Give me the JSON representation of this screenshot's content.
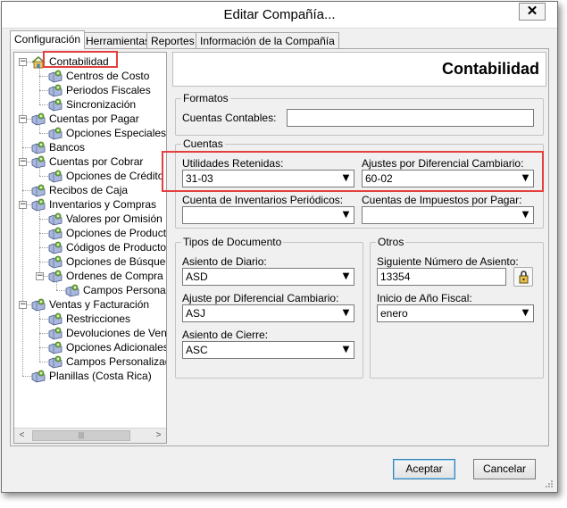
{
  "window": {
    "title": "Editar Compañía...",
    "close_glyph": "✕"
  },
  "tabs": [
    {
      "label": "Configuración",
      "active": true
    },
    {
      "label": "Herramientas",
      "active": false
    },
    {
      "label": "Reportes",
      "active": false
    },
    {
      "label": "Información de la Compañía",
      "active": false
    }
  ],
  "tree": {
    "nodes": [
      {
        "label": "Contabilidad",
        "level": 0,
        "expander": "−",
        "icon": "house-icon",
        "selected": true
      },
      {
        "label": "Centros de Costo",
        "level": 1,
        "icon": "folder-gear-icon"
      },
      {
        "label": "Periodos Fiscales",
        "level": 1,
        "icon": "folder-gear-icon"
      },
      {
        "label": "Sincronización",
        "level": 1,
        "icon": "folder-gear-icon"
      },
      {
        "label": "Cuentas por Pagar",
        "level": 0,
        "expander": "−",
        "icon": "folder-gear-icon"
      },
      {
        "label": "Opciones Especiales",
        "level": 1,
        "icon": "folder-gear-icon"
      },
      {
        "label": "Bancos",
        "level": 0,
        "icon": "folder-gear-icon"
      },
      {
        "label": "Cuentas por Cobrar",
        "level": 0,
        "expander": "−",
        "icon": "folder-gear-icon"
      },
      {
        "label": "Opciones de Crédito",
        "level": 1,
        "icon": "folder-gear-icon"
      },
      {
        "label": "Recibos de Caja",
        "level": 0,
        "icon": "folder-gear-icon"
      },
      {
        "label": "Inventarios y Compras",
        "level": 0,
        "expander": "−",
        "icon": "folder-gear-icon"
      },
      {
        "label": "Valores por Omisión",
        "level": 1,
        "icon": "folder-gear-icon"
      },
      {
        "label": "Opciones de Producto",
        "level": 1,
        "icon": "folder-gear-icon"
      },
      {
        "label": "Códigos de Producto",
        "level": 1,
        "icon": "folder-gear-icon"
      },
      {
        "label": "Opciones de Búsqueda",
        "level": 1,
        "icon": "folder-gear-icon"
      },
      {
        "label": "Ordenes de Compra",
        "level": 1,
        "expander": "−",
        "icon": "folder-gear-icon"
      },
      {
        "label": "Campos Personaliza",
        "level": 2,
        "icon": "folder-gear-icon"
      },
      {
        "label": "Ventas y Facturación",
        "level": 0,
        "expander": "−",
        "icon": "folder-gear-icon"
      },
      {
        "label": "Restricciones",
        "level": 1,
        "icon": "folder-gear-icon"
      },
      {
        "label": "Devoluciones de Venta",
        "level": 1,
        "icon": "folder-gear-icon"
      },
      {
        "label": "Opciones Adicionales",
        "level": 1,
        "icon": "folder-gear-icon"
      },
      {
        "label": "Campos Personalizados",
        "level": 1,
        "icon": "folder-gear-icon"
      },
      {
        "label": "Planillas (Costa Rica)",
        "level": 0,
        "icon": "folder-gear-icon"
      }
    ],
    "scroll_left": "<",
    "scroll_right": ">",
    "scroll_thumb": "|||"
  },
  "header": {
    "title": "Contabilidad"
  },
  "formatos": {
    "legend": "Formatos",
    "cuentas_contables_label": "Cuentas Contables:",
    "cuentas_contables_value": ""
  },
  "cuentas": {
    "legend": "Cuentas",
    "utilidades_label": "Utilidades Retenidas:",
    "utilidades_value": "31-03",
    "ajustes_label": "Ajustes por Diferencial Cambiario:",
    "ajustes_value": "60-02",
    "inventarios_label": "Cuenta de Inventarios Periódicos:",
    "inventarios_value": "",
    "impuestos_label": "Cuentas de Impuestos por Pagar:",
    "impuestos_value": ""
  },
  "tipos_documento": {
    "legend": "Tipos de Documento",
    "diario_label": "Asiento de Diario:",
    "diario_value": "ASD",
    "ajuste_label": "Ajuste por Diferencial Cambiario:",
    "ajuste_value": "ASJ",
    "cierre_label": "Asiento de Cierre:",
    "cierre_value": "ASC"
  },
  "otros": {
    "legend": "Otros",
    "siguiente_label": "Siguiente Número de Asiento:",
    "siguiente_value": "13354",
    "inicio_label": "Inicio de Año Fiscal:",
    "inicio_value": "enero"
  },
  "buttons": {
    "accept": "Aceptar",
    "cancel": "Cancelar"
  },
  "colors": {
    "highlight": "#e3403f",
    "window_bg": "#f0f0f0",
    "accent_blue": "#3c7fb1"
  }
}
